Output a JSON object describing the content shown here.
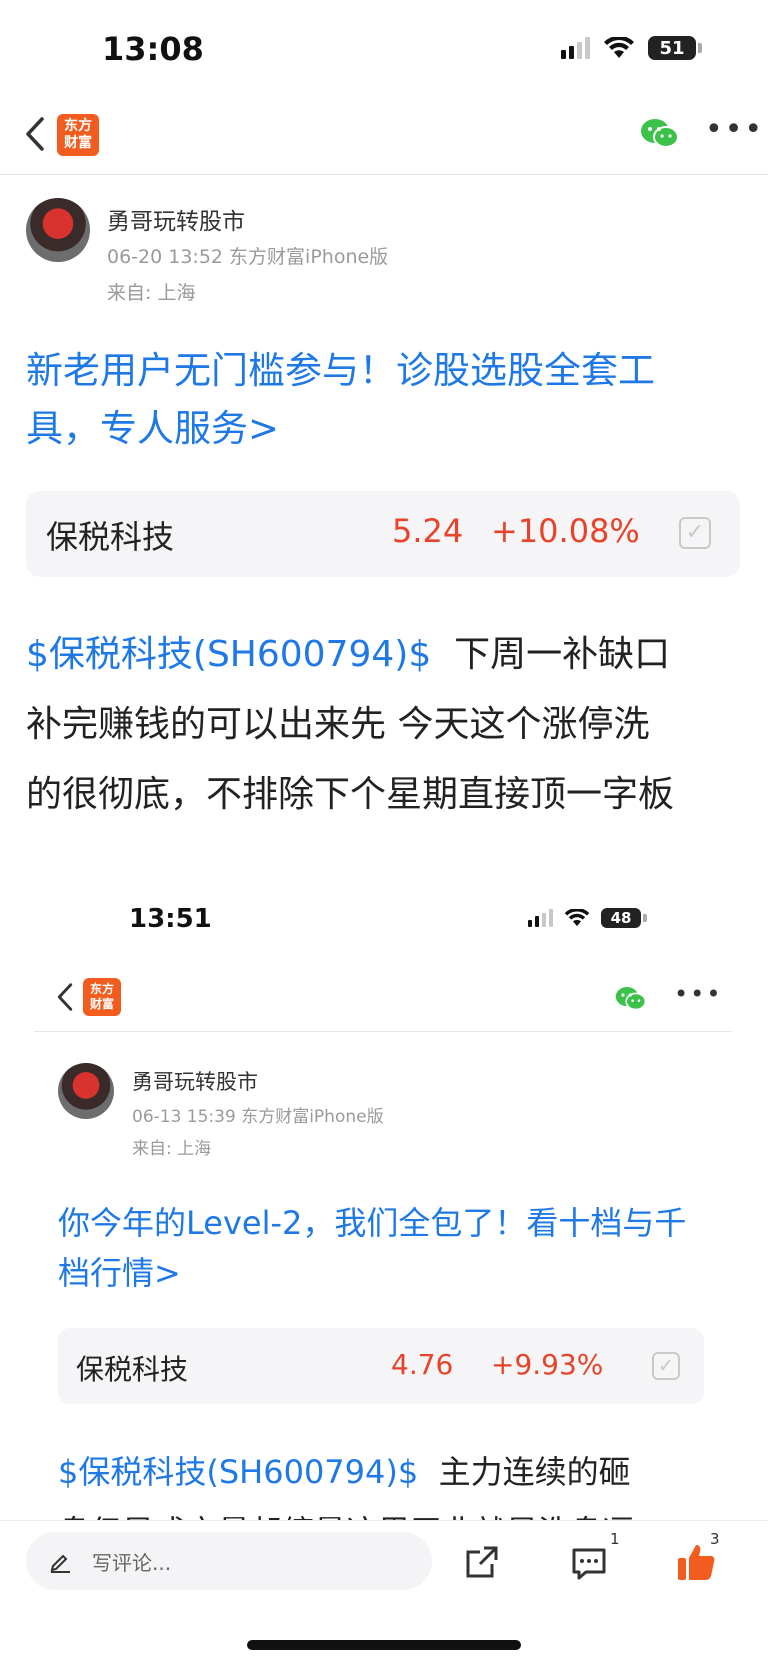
{
  "status": {
    "time": "13:08",
    "battery": "51"
  },
  "nav": {
    "logo_line1": "东方",
    "logo_line2": "财富"
  },
  "post": {
    "author": "勇哥玩转股市",
    "meta": "06-20 13:52 东方财富iPhone版",
    "location": "来自: 上海",
    "promo": "新老用户无门槛参与！诊股选股全套工具，专人服务>",
    "stock": {
      "name": "保税科技",
      "price": "5.24",
      "change": "+10.08%"
    },
    "tag": "$保税科技(SH600794)$",
    "text_line1": "下周一补缺口",
    "text_line2": "补完赚钱的可以出来先  今天这个涨停洗",
    "text_line3": "的很彻底，不排除下个星期直接顶一字板"
  },
  "embedded": {
    "time": "13:51",
    "battery": "48",
    "author": "勇哥玩转股市",
    "meta": "06-13 15:39 东方财富iPhone版",
    "location": "来自: 上海",
    "promo": "你今年的Level-2，我们全包了！看十档与千档行情>",
    "stock": {
      "name": "保税科技",
      "price": "4.76",
      "change": "+9.93%"
    },
    "tag": "$保税科技(SH600794)$",
    "text_line1": "主力连续的砸",
    "text_line2": "盘但是成交量却缩量这里无非就是洗盘逼"
  },
  "bottom": {
    "comment_placeholder": "写评论...",
    "comment_count": "1",
    "like_count": "3"
  },
  "colors": {
    "accent_blue": "#1e78e6",
    "price_red": "#e8432a",
    "brand_orange": "#f25c1e",
    "wechat_green": "#3cc24a"
  }
}
